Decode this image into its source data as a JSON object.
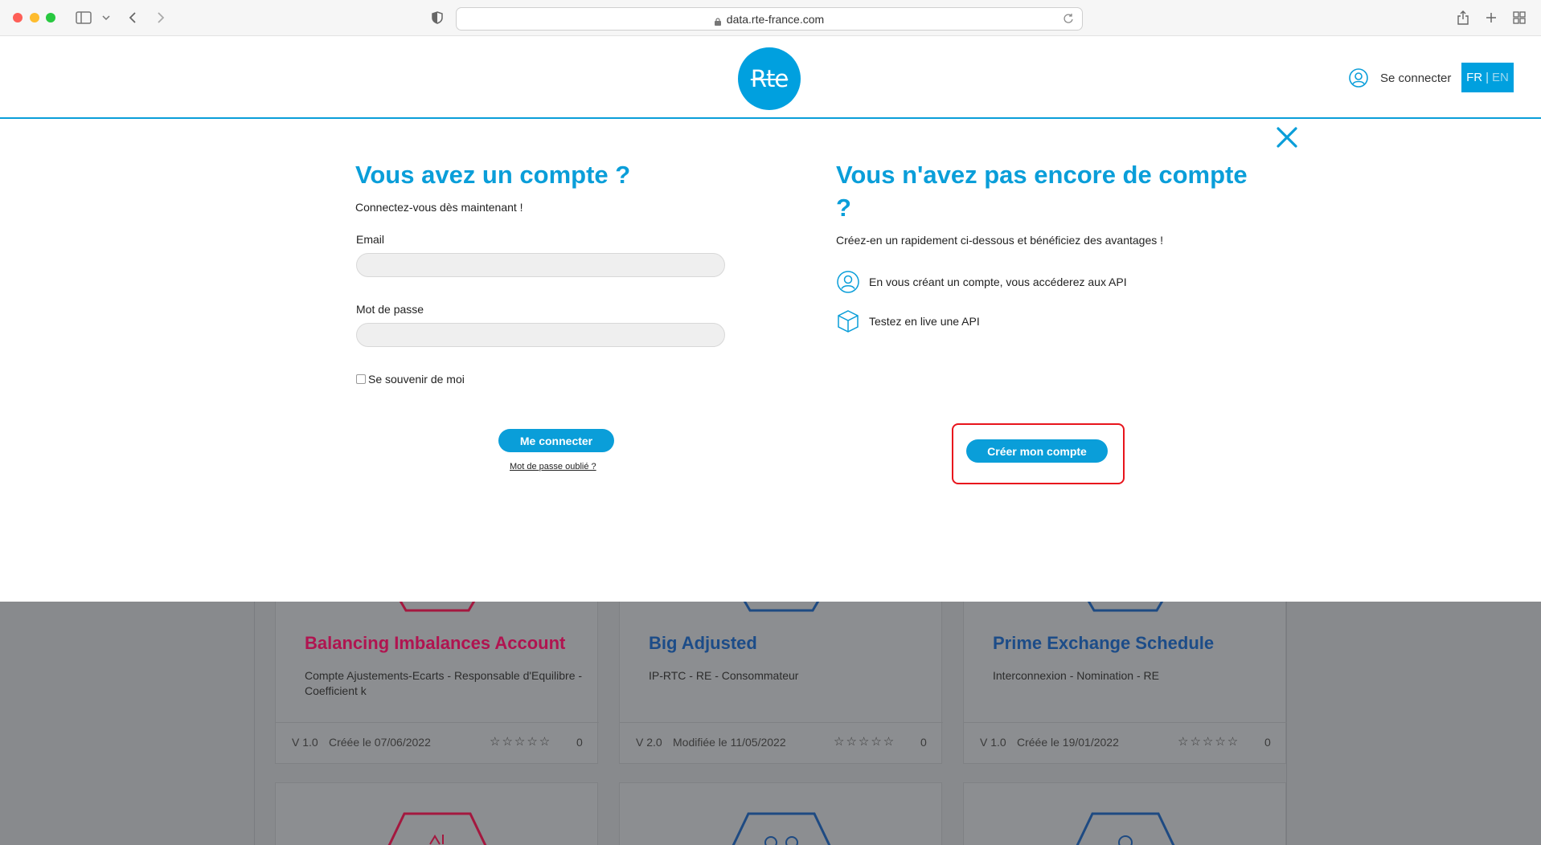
{
  "browser": {
    "url": "data.rte-france.com"
  },
  "header": {
    "logo_text": "Rte",
    "login_label": "Se connecter",
    "lang_active": "FR",
    "lang_separator": "|",
    "lang_other": "EN",
    "accent_color": "#00a0df"
  },
  "login": {
    "title": "Vous avez un compte ?",
    "subtitle": "Connectez-vous dès maintenant !",
    "email_label": "Email",
    "email_value": "",
    "password_label": "Mot de passe",
    "password_value": "",
    "remember_label": "Se souvenir de moi",
    "submit_label": "Me connecter",
    "forgot_label": "Mot de passe oublié ?"
  },
  "signup": {
    "title": "Vous n'avez pas encore de compte ?",
    "subtitle": "Créez-en un rapidement ci-dessous et bénéficiez des avantages !",
    "benefits": [
      {
        "icon": "user-icon",
        "text": "En vous créant un compte, vous accéderez aux API"
      },
      {
        "icon": "cube-icon",
        "text": "Testez en live une API"
      }
    ],
    "create_label": "Créer mon compte"
  },
  "cards": [
    {
      "title": "Balancing Imbalances Account",
      "title_color": "#c41350",
      "desc": "Compte Ajustements-Ecarts - Responsable d'Equilibre - Coefficient k",
      "version": "V 1.0",
      "date": "Créée le 07/06/2022",
      "stars": "☆☆☆☆☆",
      "rating_count": "0"
    },
    {
      "title": "Big Adjusted",
      "title_color": "#1d4f8e",
      "desc": "IP-RTC - RE - Consommateur",
      "version": "V 2.0",
      "date": "Modifiée le 11/05/2022",
      "stars": "☆☆☆☆☆",
      "rating_count": "0"
    },
    {
      "title": "Prime Exchange Schedule",
      "title_color": "#1d4f8e",
      "desc": "Interconnexion - Nomination - RE",
      "version": "V 1.0",
      "date": "Créée le 19/01/2022",
      "stars": "☆☆☆☆☆",
      "rating_count": "0"
    }
  ]
}
